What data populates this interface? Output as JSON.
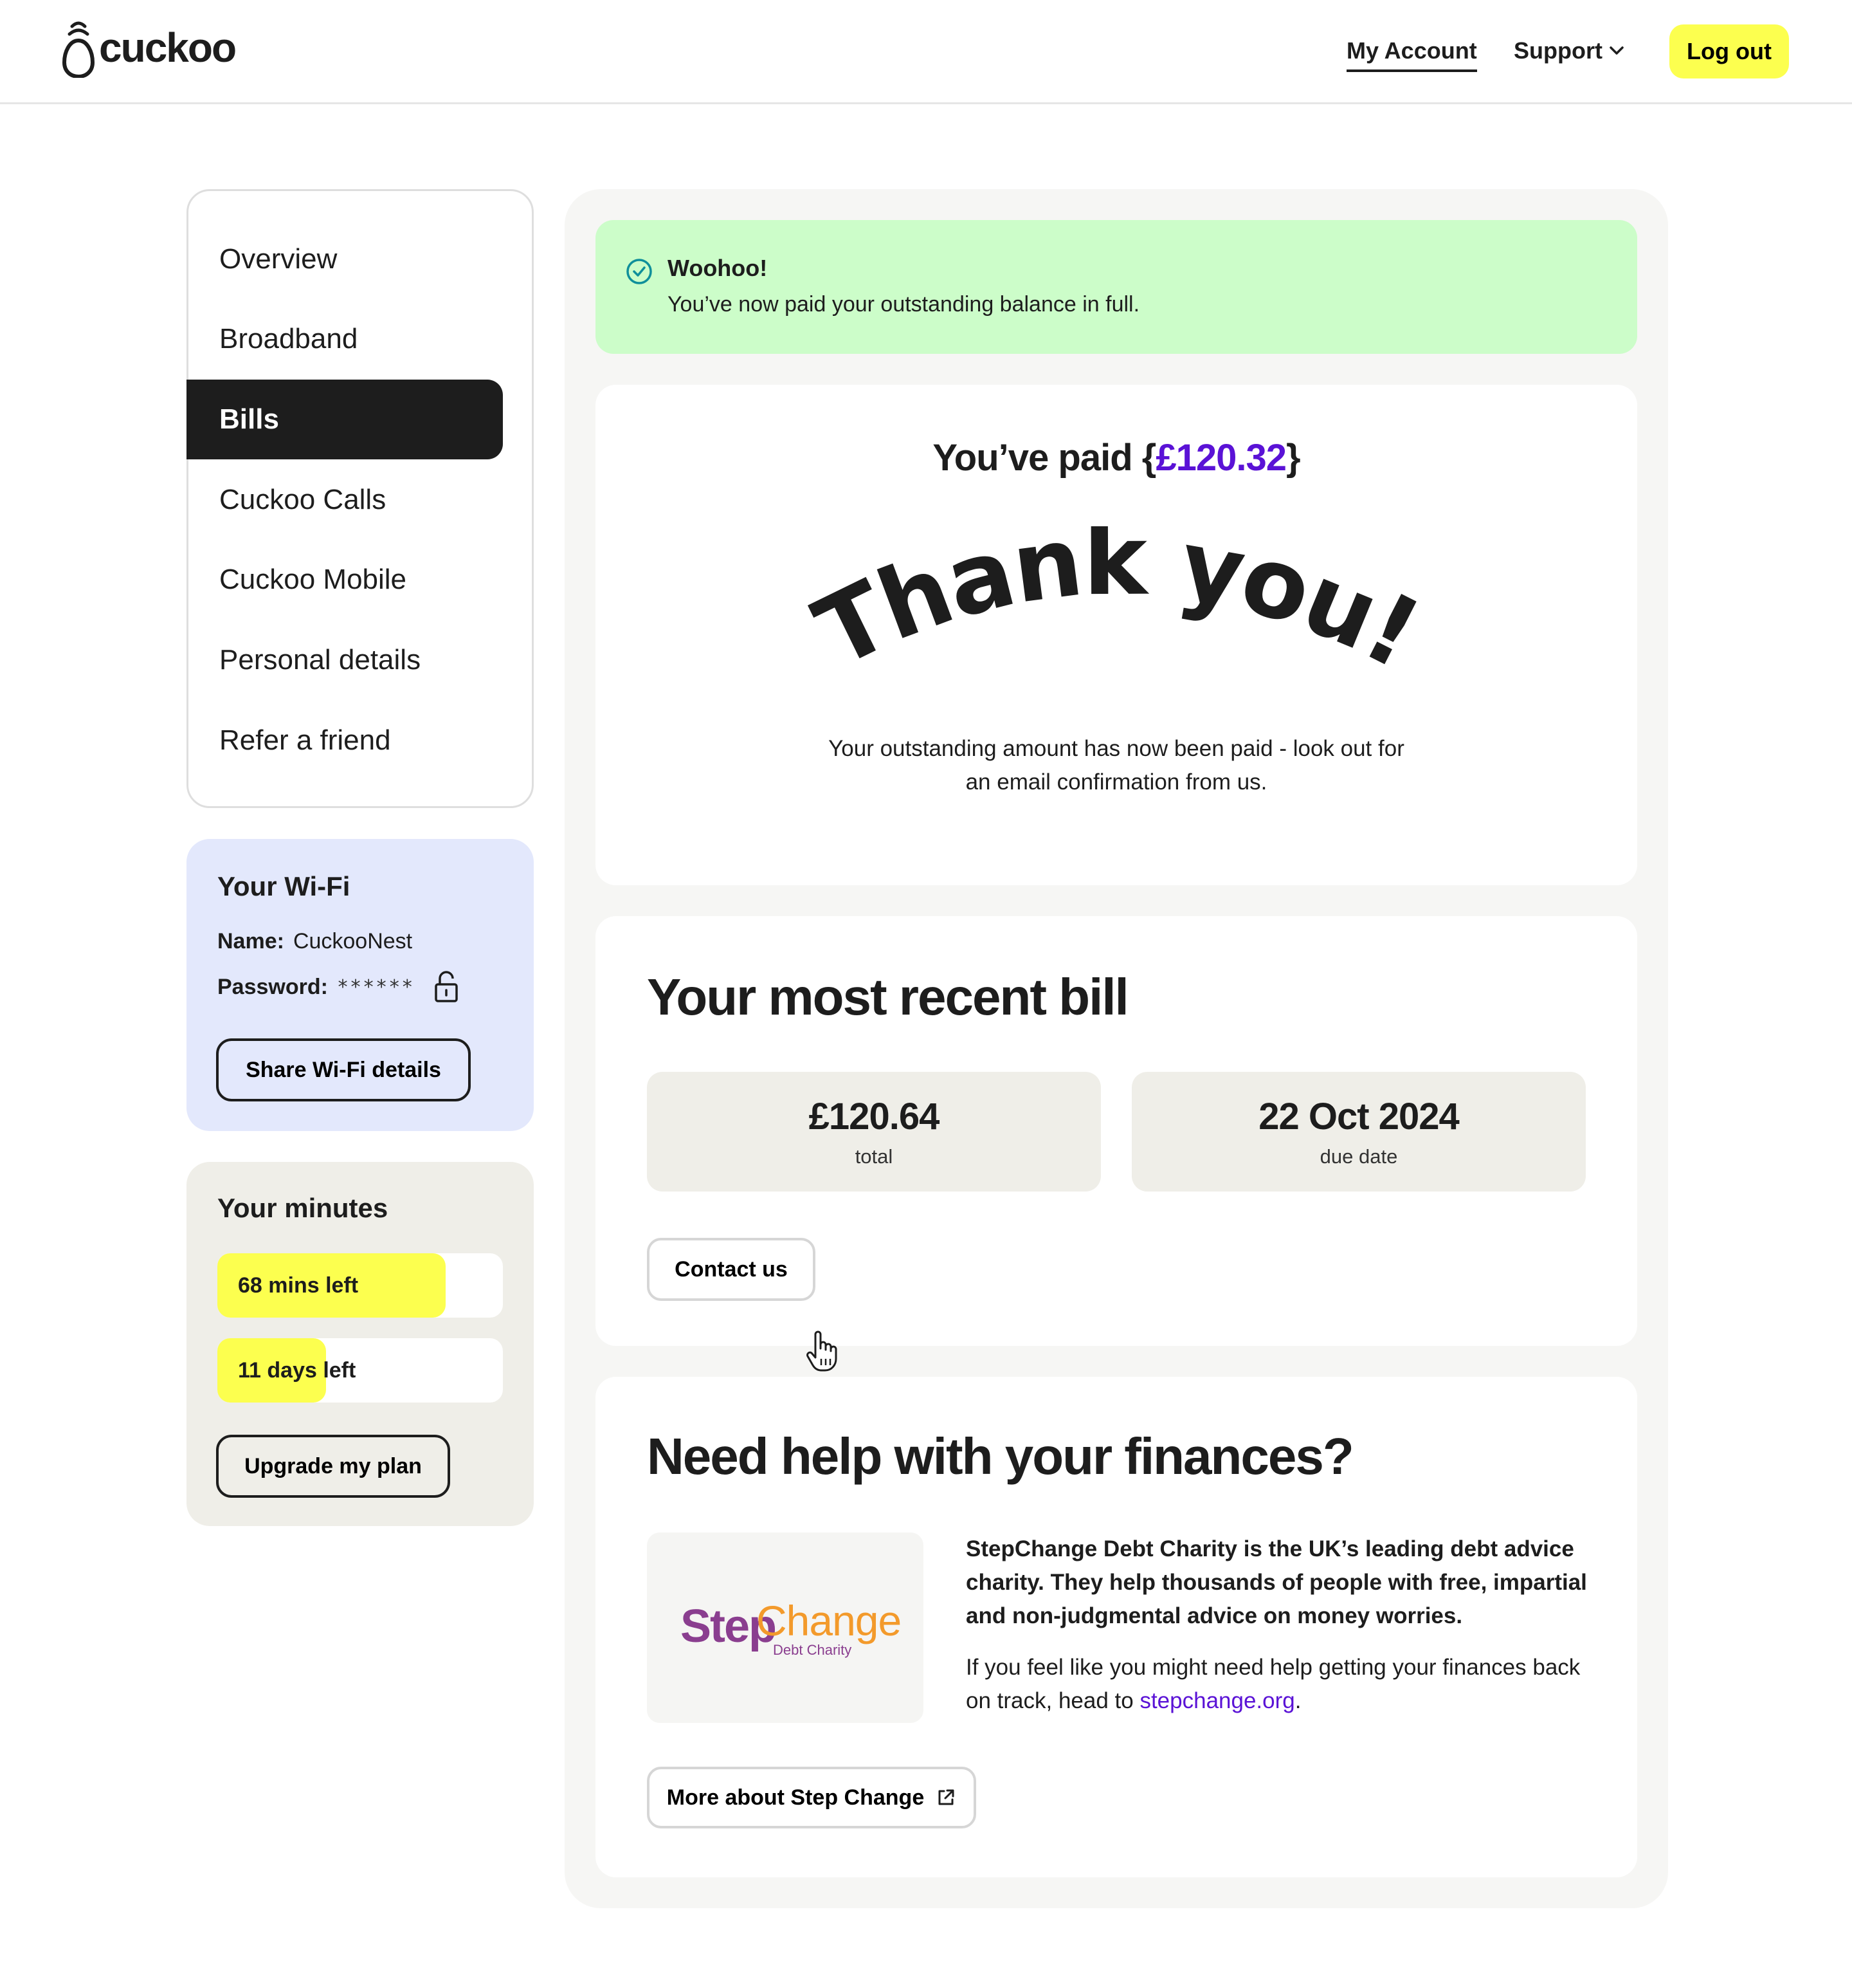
{
  "header": {
    "logo_text": "cuckoo",
    "nav": {
      "my_account": "My Account",
      "support": "Support",
      "logout": "Log out"
    }
  },
  "sidebar": {
    "items": [
      {
        "label": "Overview"
      },
      {
        "label": "Broadband"
      },
      {
        "label": "Bills"
      },
      {
        "label": "Cuckoo Calls"
      },
      {
        "label": "Cuckoo Mobile"
      },
      {
        "label": "Personal details"
      },
      {
        "label": "Refer a friend"
      }
    ],
    "active_item": "Bills"
  },
  "wifi": {
    "title": "Your Wi-Fi",
    "name_label": "Name:",
    "name_value": "CuckooNest",
    "password_label": "Password:",
    "password_value": "******",
    "lock_icon": "unlock-icon",
    "share_button": "Share Wi-Fi details",
    "background_color": "#e3e8fc"
  },
  "minutes": {
    "title": "Your minutes",
    "mins_left": {
      "label": "68 mins left",
      "fraction": 0.8
    },
    "days_left": {
      "label": "11 days left",
      "fraction": 0.38
    },
    "upgrade_button": "Upgrade my plan",
    "bar_color": "#fcff4f"
  },
  "alert": {
    "icon": "check-circle-icon",
    "title": "Woohoo!",
    "text": "You’ve now paid your outstanding balance in full.",
    "background_color": "#ccfdc9"
  },
  "payment": {
    "paid_prefix": "You’ve paid {",
    "paid_amount": "£120.32",
    "paid_suffix": "}",
    "thank_you": "Thank you!",
    "description": "Your outstanding amount has now been paid - look out for an email confirmation from us.",
    "accent_color": "#5a12d6"
  },
  "recent_bill": {
    "title": "Your most recent bill",
    "total_value": "£120.64",
    "total_label": "total",
    "due_value": "22 Oct 2024",
    "due_label": "due date",
    "contact_button": "Contact us"
  },
  "finance_help": {
    "title": "Need help with your finances?",
    "logo_main": "StepChange",
    "logo_step": "Step",
    "logo_change": "Change",
    "logo_sub": "Debt Charity",
    "bold_text": "StepChange Debt Charity is the UK’s leading debt advice charity. They help thousands of people with free, impartial and non-judgmental advice on money worries.",
    "normal_text_prefix": "If you feel like you might need help getting your finances back on track, head to ",
    "link_text": "stepchange.org",
    "normal_text_suffix": ".",
    "more_button": "More about Step Change",
    "external_icon": "external-link-icon"
  }
}
